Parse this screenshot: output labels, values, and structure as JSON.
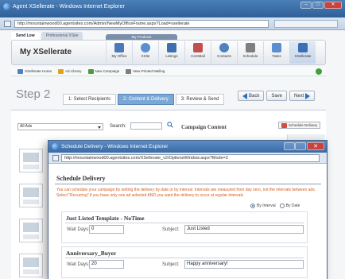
{
  "browser": {
    "title": "Agent XSellerate - Windows Internet Explorer",
    "address": "http://mountainwood00.agentsites.com/Admin/NewMyOfficeFrame.aspx?Load=xsellerate"
  },
  "app": {
    "tabs": [
      "Send Low",
      "Professional XSite"
    ],
    "nav_strip_label": "My Products",
    "title": "My XSellerate",
    "nav": [
      {
        "label": "My Office",
        "color": "#4a78b8"
      },
      {
        "label": "XSite",
        "color": "#5a8fcf"
      },
      {
        "label": "Listings",
        "color": "#3d6fb0"
      },
      {
        "label": "CentMail",
        "color": "#c0504d"
      },
      {
        "label": "Contacts",
        "color": "#4f81bd"
      },
      {
        "label": "Schedule",
        "color": "#7f7f7f"
      },
      {
        "label": "Tasks",
        "color": "#5a8fcf"
      },
      {
        "label": "XSellerate",
        "color": "#3b6fb5"
      }
    ],
    "subnav": [
      {
        "label": "XSellerate Home",
        "color": "#4f81bd"
      },
      {
        "label": "Ad Library",
        "color": "#e4a11b"
      },
      {
        "label": "New Campaign",
        "color": "#4f9a3d"
      },
      {
        "label": "New Printed Mailing",
        "color": "#7f7f7f"
      }
    ]
  },
  "wizard": {
    "step_title": "Step 2",
    "steps": [
      "1: Select Recipients",
      "2: Content & Delivery",
      "3: Review & Send"
    ],
    "active_step": 1,
    "buttons": {
      "back": "Back",
      "save": "Save",
      "next": "Next"
    }
  },
  "content": {
    "ads_filter": "All Ads",
    "search_label": "Search:",
    "campaign_heading": "Campaign Content",
    "schedule_button": "Schedule Delivery"
  },
  "popup": {
    "title": "Schedule Delivery - Windows Internet Explorer",
    "address": "http://mountainwood00.agentsites.com/XSellerate_v2/OptionsWindow.aspx?Mode=2",
    "heading": "Schedule Delivery",
    "description": "You can schedule your campaign by setting the delivery by date or by interval. Intervals are measured from day zero, not the intervals between ads. Select \"Recurring\" if you have only one ad selected AND you want the delivery to occur at regular intervals",
    "radios": [
      {
        "label": "By Interval",
        "selected": true
      },
      {
        "label": "By Date",
        "selected": false
      }
    ],
    "templates": [
      {
        "name": "Just Listed Template - NoTime",
        "wait_label": "Wait Days:",
        "wait_days": "0",
        "subject_label": "Subject:",
        "subject": "Just Listed"
      },
      {
        "name": "Anniversary_Buyer",
        "wait_label": "Wait Days:",
        "wait_days": "20",
        "subject_label": "Subject:",
        "subject": "Happy anniversary!"
      }
    ]
  }
}
